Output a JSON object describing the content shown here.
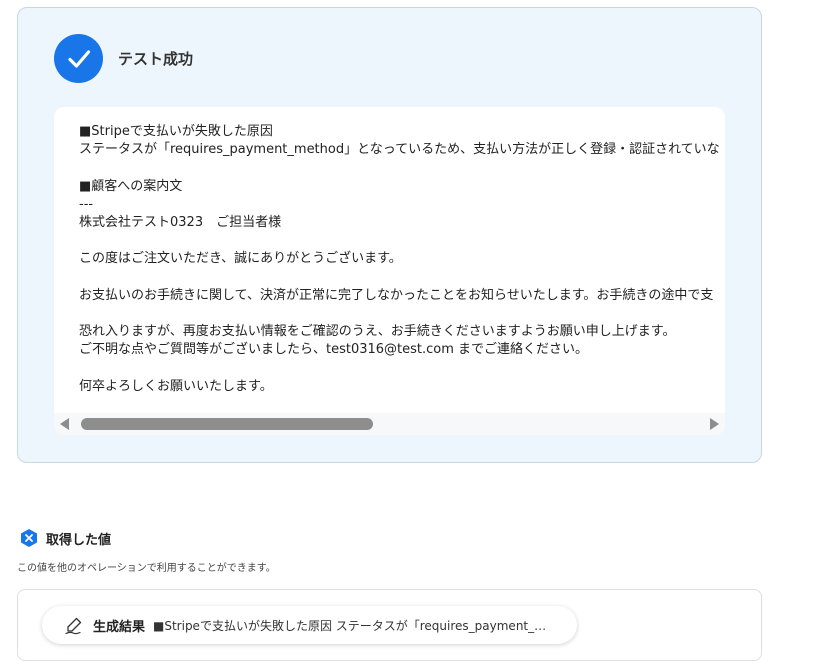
{
  "test_panel": {
    "status_icon": "check-circle-icon",
    "title": "テスト成功",
    "output_text": "■Stripeで支払いが失敗した原因\nステータスが「requires_payment_method」となっているため、支払い方法が正しく登録・認証されていな\n\n■顧客への案内文\n---\n株式会社テスト0323　ご担当者様\n\nこの度はご注文いただき、誠にありがとうございます。\n\nお支払いのお手続きに関して、決済が正常に完了しなかったことをお知らせいたします。お手続きの途中で支\n\n恐れ入りますが、再度お支払い情報をご確認のうえ、お手続きくださいますようお願い申し上げます。\nご不明な点やご質問等がございましたら、test0316@test.com までご連絡ください。\n\n何卒よろしくお願いいたします。"
  },
  "acquired_values": {
    "icon": "x-badge-icon",
    "title": "取得した値",
    "description": "この値を他のオペレーションで利用することができます。",
    "items": [
      {
        "icon": "pen-icon",
        "label": "生成結果",
        "value": "■Stripeで支払いが失敗した原因 ステータスが「requires_payment_m..."
      }
    ]
  },
  "colors": {
    "accent": "#1976e8",
    "panel_bg": "#eef6fd",
    "scroll": "#8d8d8d"
  }
}
